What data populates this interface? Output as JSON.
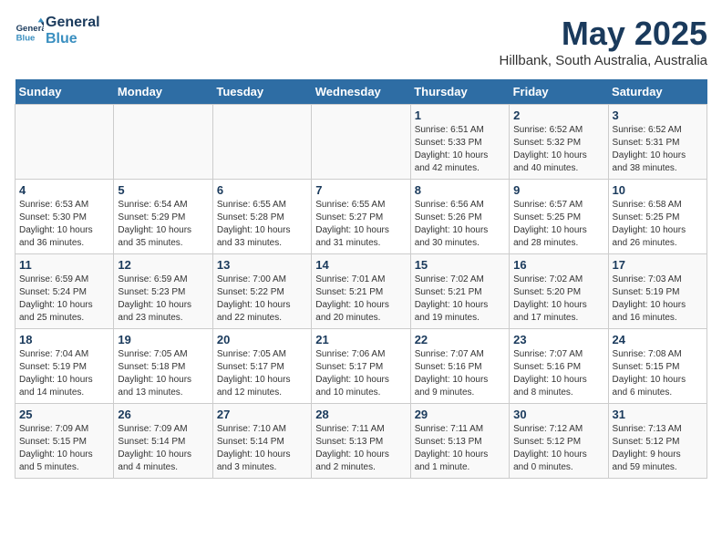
{
  "header": {
    "logo_line1": "General",
    "logo_line2": "Blue",
    "month_title": "May 2025",
    "subtitle": "Hillbank, South Australia, Australia"
  },
  "days_of_week": [
    "Sunday",
    "Monday",
    "Tuesday",
    "Wednesday",
    "Thursday",
    "Friday",
    "Saturday"
  ],
  "weeks": [
    [
      {
        "day": "",
        "info": ""
      },
      {
        "day": "",
        "info": ""
      },
      {
        "day": "",
        "info": ""
      },
      {
        "day": "",
        "info": ""
      },
      {
        "day": "1",
        "info": "Sunrise: 6:51 AM\nSunset: 5:33 PM\nDaylight: 10 hours\nand 42 minutes."
      },
      {
        "day": "2",
        "info": "Sunrise: 6:52 AM\nSunset: 5:32 PM\nDaylight: 10 hours\nand 40 minutes."
      },
      {
        "day": "3",
        "info": "Sunrise: 6:52 AM\nSunset: 5:31 PM\nDaylight: 10 hours\nand 38 minutes."
      }
    ],
    [
      {
        "day": "4",
        "info": "Sunrise: 6:53 AM\nSunset: 5:30 PM\nDaylight: 10 hours\nand 36 minutes."
      },
      {
        "day": "5",
        "info": "Sunrise: 6:54 AM\nSunset: 5:29 PM\nDaylight: 10 hours\nand 35 minutes."
      },
      {
        "day": "6",
        "info": "Sunrise: 6:55 AM\nSunset: 5:28 PM\nDaylight: 10 hours\nand 33 minutes."
      },
      {
        "day": "7",
        "info": "Sunrise: 6:55 AM\nSunset: 5:27 PM\nDaylight: 10 hours\nand 31 minutes."
      },
      {
        "day": "8",
        "info": "Sunrise: 6:56 AM\nSunset: 5:26 PM\nDaylight: 10 hours\nand 30 minutes."
      },
      {
        "day": "9",
        "info": "Sunrise: 6:57 AM\nSunset: 5:25 PM\nDaylight: 10 hours\nand 28 minutes."
      },
      {
        "day": "10",
        "info": "Sunrise: 6:58 AM\nSunset: 5:25 PM\nDaylight: 10 hours\nand 26 minutes."
      }
    ],
    [
      {
        "day": "11",
        "info": "Sunrise: 6:59 AM\nSunset: 5:24 PM\nDaylight: 10 hours\nand 25 minutes."
      },
      {
        "day": "12",
        "info": "Sunrise: 6:59 AM\nSunset: 5:23 PM\nDaylight: 10 hours\nand 23 minutes."
      },
      {
        "day": "13",
        "info": "Sunrise: 7:00 AM\nSunset: 5:22 PM\nDaylight: 10 hours\nand 22 minutes."
      },
      {
        "day": "14",
        "info": "Sunrise: 7:01 AM\nSunset: 5:21 PM\nDaylight: 10 hours\nand 20 minutes."
      },
      {
        "day": "15",
        "info": "Sunrise: 7:02 AM\nSunset: 5:21 PM\nDaylight: 10 hours\nand 19 minutes."
      },
      {
        "day": "16",
        "info": "Sunrise: 7:02 AM\nSunset: 5:20 PM\nDaylight: 10 hours\nand 17 minutes."
      },
      {
        "day": "17",
        "info": "Sunrise: 7:03 AM\nSunset: 5:19 PM\nDaylight: 10 hours\nand 16 minutes."
      }
    ],
    [
      {
        "day": "18",
        "info": "Sunrise: 7:04 AM\nSunset: 5:19 PM\nDaylight: 10 hours\nand 14 minutes."
      },
      {
        "day": "19",
        "info": "Sunrise: 7:05 AM\nSunset: 5:18 PM\nDaylight: 10 hours\nand 13 minutes."
      },
      {
        "day": "20",
        "info": "Sunrise: 7:05 AM\nSunset: 5:17 PM\nDaylight: 10 hours\nand 12 minutes."
      },
      {
        "day": "21",
        "info": "Sunrise: 7:06 AM\nSunset: 5:17 PM\nDaylight: 10 hours\nand 10 minutes."
      },
      {
        "day": "22",
        "info": "Sunrise: 7:07 AM\nSunset: 5:16 PM\nDaylight: 10 hours\nand 9 minutes."
      },
      {
        "day": "23",
        "info": "Sunrise: 7:07 AM\nSunset: 5:16 PM\nDaylight: 10 hours\nand 8 minutes."
      },
      {
        "day": "24",
        "info": "Sunrise: 7:08 AM\nSunset: 5:15 PM\nDaylight: 10 hours\nand 6 minutes."
      }
    ],
    [
      {
        "day": "25",
        "info": "Sunrise: 7:09 AM\nSunset: 5:15 PM\nDaylight: 10 hours\nand 5 minutes."
      },
      {
        "day": "26",
        "info": "Sunrise: 7:09 AM\nSunset: 5:14 PM\nDaylight: 10 hours\nand 4 minutes."
      },
      {
        "day": "27",
        "info": "Sunrise: 7:10 AM\nSunset: 5:14 PM\nDaylight: 10 hours\nand 3 minutes."
      },
      {
        "day": "28",
        "info": "Sunrise: 7:11 AM\nSunset: 5:13 PM\nDaylight: 10 hours\nand 2 minutes."
      },
      {
        "day": "29",
        "info": "Sunrise: 7:11 AM\nSunset: 5:13 PM\nDaylight: 10 hours\nand 1 minute."
      },
      {
        "day": "30",
        "info": "Sunrise: 7:12 AM\nSunset: 5:12 PM\nDaylight: 10 hours\nand 0 minutes."
      },
      {
        "day": "31",
        "info": "Sunrise: 7:13 AM\nSunset: 5:12 PM\nDaylight: 9 hours\nand 59 minutes."
      }
    ]
  ]
}
